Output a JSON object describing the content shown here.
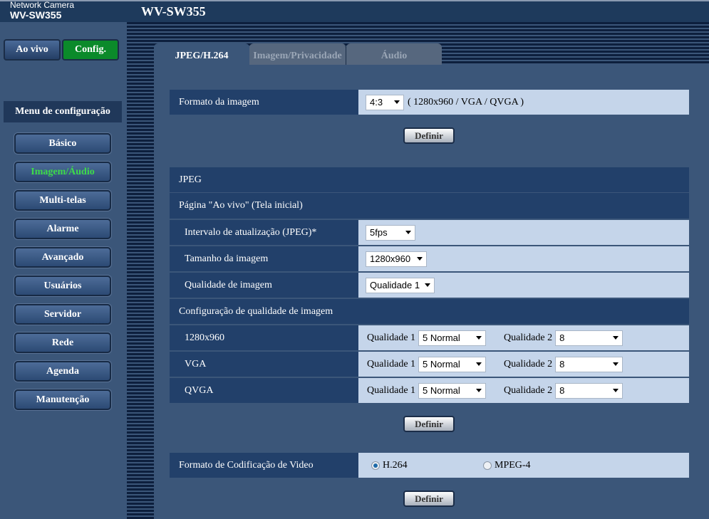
{
  "header": {
    "brand_small": "Network Camera",
    "brand_model": "WV-SW355",
    "title": "WV-SW355"
  },
  "top_buttons": {
    "live": "Ao vivo",
    "config": "Config."
  },
  "sidebar": {
    "title": "Menu de configuração",
    "items": [
      {
        "label": "Básico"
      },
      {
        "label": "Imagem/Áudio",
        "active": true
      },
      {
        "label": "Multi-telas"
      },
      {
        "label": "Alarme"
      },
      {
        "label": "Avançado"
      },
      {
        "label": "Usuários"
      },
      {
        "label": "Servidor"
      },
      {
        "label": "Rede"
      },
      {
        "label": "Agenda"
      },
      {
        "label": "Manutenção"
      }
    ]
  },
  "tabs": [
    {
      "label": "JPEG/H.264",
      "active": true
    },
    {
      "label": "Imagem/Privacidade"
    },
    {
      "label": "Áudio"
    }
  ],
  "image_format": {
    "label": "Formato da imagem",
    "value": "4:3",
    "note": "( 1280x960 / VGA / QVGA )"
  },
  "set_label": "Definir",
  "jpeg": {
    "section": "JPEG",
    "live_page": "Página \"Ao vivo\" (Tela inicial)",
    "refresh": {
      "label": "Intervalo de atualização (JPEG)*",
      "value": "5fps"
    },
    "size": {
      "label": "Tamanho da imagem",
      "value": "1280x960"
    },
    "quality": {
      "label": "Qualidade de imagem",
      "value": "Qualidade 1"
    },
    "quality_config": "Configuração de qualidade de imagem",
    "rows": [
      {
        "label": "1280x960",
        "q1_label": "Qualidade 1",
        "q1": "5 Normal",
        "q2_label": "Qualidade 2",
        "q2": "8"
      },
      {
        "label": "VGA",
        "q1_label": "Qualidade 1",
        "q1": "5 Normal",
        "q2_label": "Qualidade 2",
        "q2": "8"
      },
      {
        "label": "QVGA",
        "q1_label": "Qualidade 1",
        "q1": "5 Normal",
        "q2_label": "Qualidade 2",
        "q2": "8"
      }
    ]
  },
  "video_coding": {
    "label": "Formato de Codificação de Video",
    "options": [
      {
        "label": "H.264",
        "selected": true
      },
      {
        "label": "MPEG-4",
        "selected": false
      }
    ]
  },
  "colors": {
    "active_menu": "#3ddc4a",
    "config_button": "#0b8a2a",
    "label_cell": "#22406a",
    "value_cell": "#c5d5ea"
  }
}
